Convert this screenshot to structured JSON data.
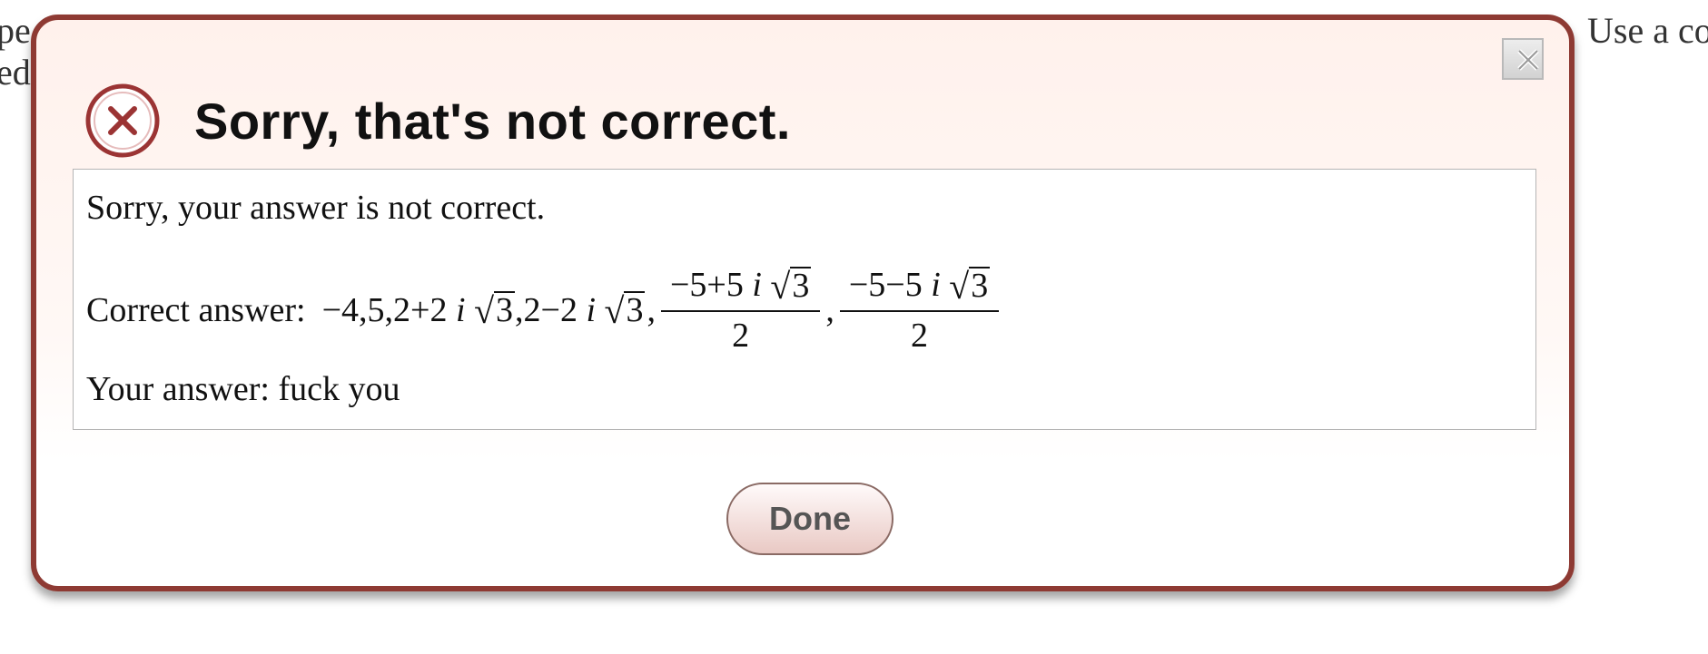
{
  "background": {
    "line1_left": "pe",
    "line1_right": "Use a com",
    "line2_left": "ed"
  },
  "dialog": {
    "title": "Sorry, that's not correct.",
    "close_icon": "close-x-icon",
    "error_icon": "error-circle-x-icon",
    "message": "Sorry, your answer is not correct.",
    "correct_answer_label": "Correct answer:",
    "correct_answer": {
      "term1": "−4,5,2+2",
      "i": "i",
      "radicand": "3",
      "term2": ",2−2",
      "comma": ",",
      "frac1_numerator_prefix": "−5+5",
      "frac2_numerator_prefix": "−5−5",
      "denominator": "2"
    },
    "your_answer_label": "Your answer: fuck you",
    "done_label": "Done"
  },
  "colors": {
    "dialog_border": "#8e3a33",
    "dialog_bg_top": "#fff1ec",
    "error_icon": "#9b3434",
    "done_button_bottom": "#e9c9c4"
  }
}
